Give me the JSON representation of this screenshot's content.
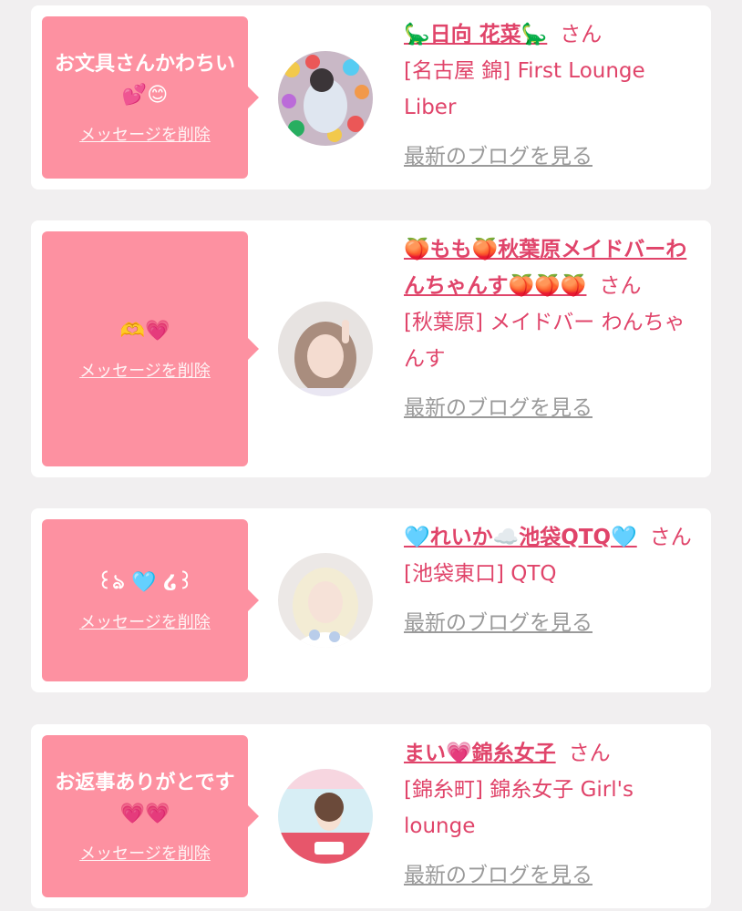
{
  "cards": [
    {
      "message": "お文具さんかわちい💕😊",
      "delete_label": "メッセージを削除",
      "name": "🦕日向 花菜🦕",
      "honorific": "さん",
      "shop": "[名古屋 錦] First Lounge Liber",
      "blog_label": "最新のブログを見る"
    },
    {
      "message": "🫶💗",
      "delete_label": "メッセージを削除",
      "name": "🍑もも🍑秋葉原メイドバーわんちゃんす🍑🍑🍑",
      "honorific": "さん",
      "shop": "[秋葉原] メイドバー わんちゃんす",
      "blog_label": "最新のブログを見る"
    },
    {
      "message": "꒰ঌ 🩵 ໒꒱",
      "delete_label": "メッセージを削除",
      "name": "🩵れいか☁️池袋QTQ🩵",
      "honorific": "さん",
      "shop": "[池袋東口] QTQ",
      "blog_label": "最新のブログを見る"
    },
    {
      "message": "お返事ありがとです💗💗",
      "delete_label": "メッセージを削除",
      "name": "まい💗錦糸女子",
      "honorific": "さん",
      "shop": "[錦糸町] 錦糸女子 Girl's lounge",
      "blog_label": "最新のブログを見る"
    }
  ]
}
